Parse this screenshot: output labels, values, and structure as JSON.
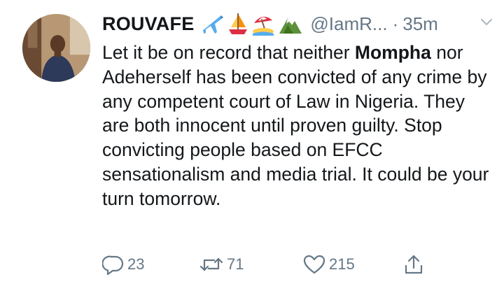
{
  "tweet": {
    "display_name": "ROUVAFE",
    "name_emojis": [
      "airplane-emoji",
      "sailboat-emoji",
      "beach-umbrella-emoji",
      "mountain-emoji"
    ],
    "handle": "@IamR...",
    "separator": "·",
    "time": "35m",
    "text_before_bold": "Let it be on record that neither ",
    "text_bold": "Mompha",
    "text_after_bold": " nor Adeherself has been convicted of any crime by any competent court of Law in Nigeria. They are both innocent until proven guilty. Stop convicting people based on EFCC sensationalism and media trial. It could be your turn tomorrow.",
    "actions": {
      "reply_count": "23",
      "retweet_count": "71",
      "like_count": "215"
    }
  },
  "colors": {
    "text": "#14171a",
    "secondary": "#657786",
    "background": "#ffffff"
  }
}
